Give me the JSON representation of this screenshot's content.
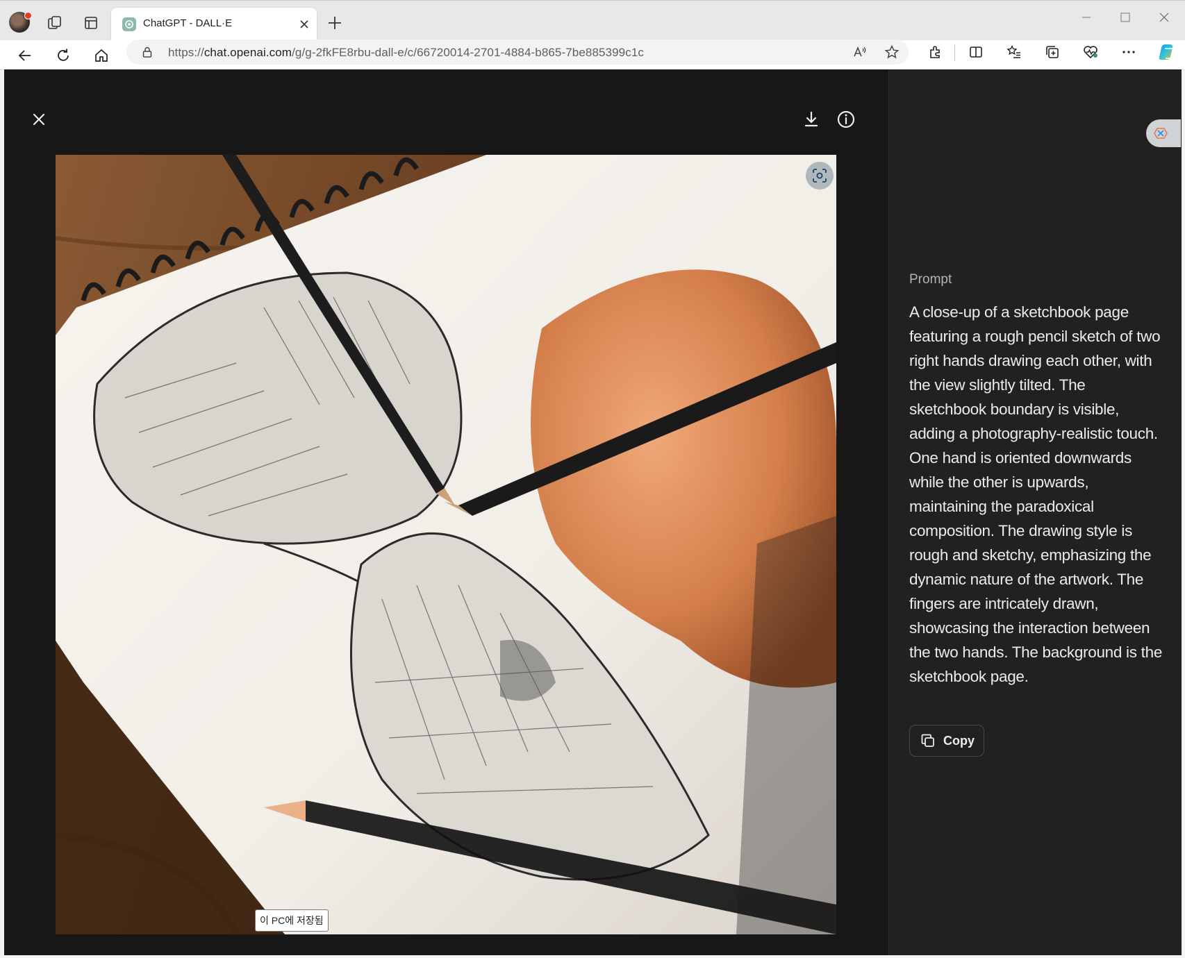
{
  "browser": {
    "tab_title": "ChatGPT - DALL·E",
    "url_prefix": "https://",
    "url_host": "chat.openai.com",
    "url_path": "/g/g-2fkFE8rbu-dall-e/c/66720014-2701-4884-b865-7be885399c1c"
  },
  "viewer": {
    "saved_tooltip": "이 PC에 저장됨"
  },
  "side_panel": {
    "prompt_label": "Prompt",
    "prompt_text": "A close-up of a sketchbook page featuring a rough pencil sketch of two right hands drawing each other, with the view slightly tilted. The sketchbook boundary is visible, adding a photography-realistic touch. One hand is oriented downwards while the other is upwards, maintaining the paradoxical composition. The drawing style is rough and sketchy, emphasizing the dynamic nature of the artwork. The fingers are intricately drawn, showcasing the interaction between the two hands. The background is the sketchbook page.",
    "copy_label": "Copy"
  },
  "icons": [
    "profile-avatar",
    "workspaces-icon",
    "tab-actions-icon",
    "chatgpt-favicon",
    "close-tab-icon",
    "new-tab-icon",
    "minimize-icon",
    "maximize-icon",
    "close-window-icon",
    "back-icon",
    "refresh-icon",
    "home-icon",
    "lock-icon",
    "read-aloud-icon",
    "favorite-star-icon",
    "extensions-icon",
    "split-screen-icon",
    "favorites-icon",
    "collections-icon",
    "browser-essentials-icon",
    "more-icon",
    "copilot-icon",
    "close-icon",
    "download-icon",
    "info-icon",
    "lens-icon",
    "copy-icon"
  ],
  "colors": {
    "viewer_bg": "#171717",
    "side_panel_bg": "#212121",
    "text_primary": "#ececec",
    "text_secondary": "#b4b4b4"
  }
}
